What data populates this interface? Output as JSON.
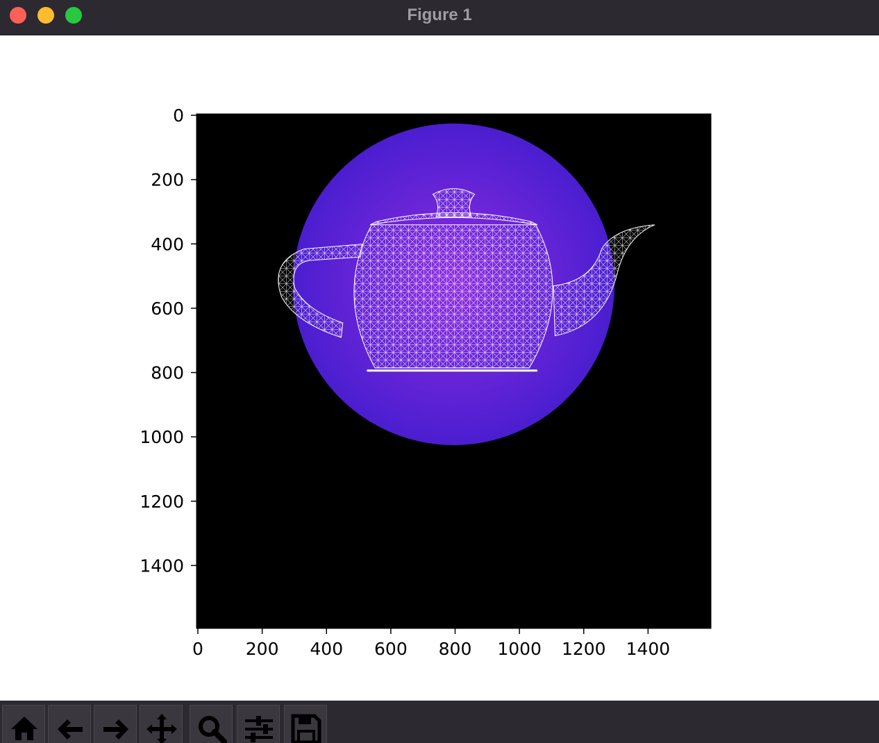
{
  "window": {
    "title": "Figure 1"
  },
  "toolbar": {
    "buttons": [
      {
        "icon": "home-icon"
      },
      {
        "icon": "back-arrow-icon"
      },
      {
        "icon": "forward-arrow-icon"
      },
      {
        "icon": "pan-move-icon"
      },
      {
        "icon": "zoom-magnifier-icon"
      },
      {
        "icon": "configure-subplots-icon"
      },
      {
        "icon": "save-floppy-icon"
      }
    ]
  },
  "colors": {
    "titlebar": "#2c2930",
    "close": "#fe5f57",
    "minimize": "#febc2e",
    "maximize": "#28c840",
    "image_background": "#000000",
    "sphere_center": "#8a2be2",
    "sphere_edge": "#4a1ed0",
    "wireframe": "#ffffff"
  },
  "chart_data": {
    "type": "image",
    "xlim": [
      0,
      1600
    ],
    "ylim": [
      1600,
      0
    ],
    "x_ticks": [
      "0",
      "200",
      "400",
      "600",
      "800",
      "1000",
      "1200",
      "1400"
    ],
    "y_ticks": [
      "0",
      "200",
      "400",
      "600",
      "800",
      "1000",
      "1200",
      "1400"
    ],
    "grid": false
  }
}
